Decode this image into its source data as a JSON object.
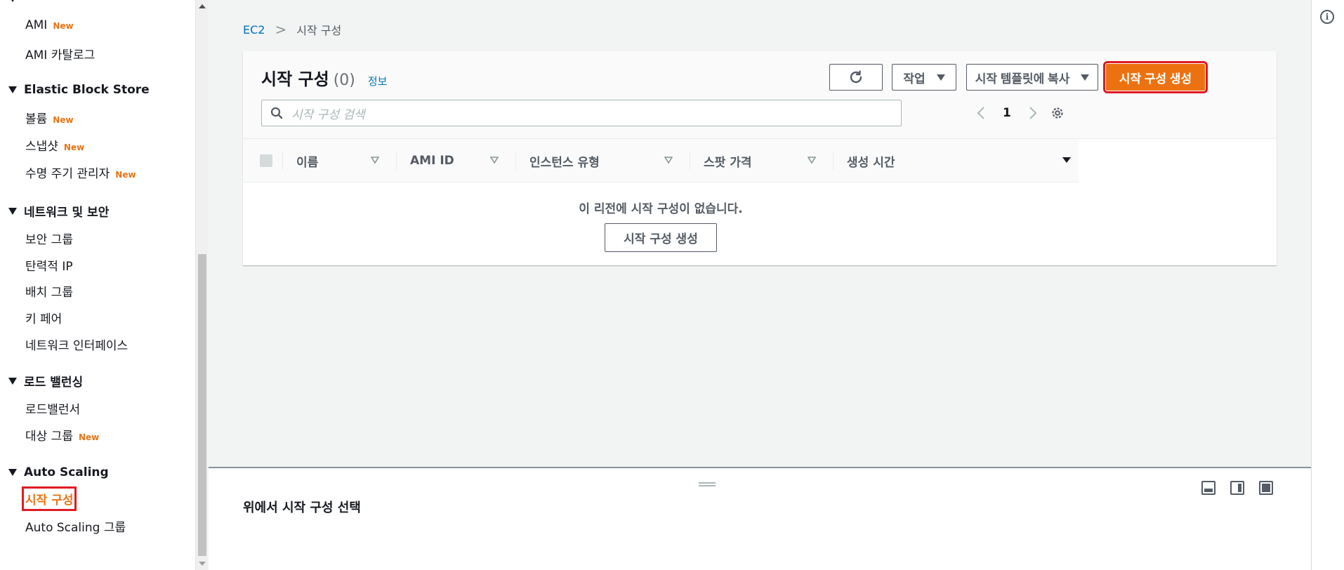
{
  "sidebar": {
    "items": [
      {
        "label": "AMI",
        "badge": "New"
      },
      {
        "label": "AMI 카탈로그",
        "badge": ""
      }
    ],
    "sections": [
      {
        "title": "Elastic Block Store",
        "items": [
          {
            "label": "볼륨",
            "badge": "New"
          },
          {
            "label": "스냅샷",
            "badge": "New"
          },
          {
            "label": "수명 주기 관리자",
            "badge": "New"
          }
        ]
      },
      {
        "title": "네트워크 및 보안",
        "items": [
          {
            "label": "보안 그룹",
            "badge": ""
          },
          {
            "label": "탄력적 IP",
            "badge": ""
          },
          {
            "label": "배치 그룹",
            "badge": ""
          },
          {
            "label": "키 페어",
            "badge": ""
          },
          {
            "label": "네트워크 인터페이스",
            "badge": ""
          }
        ]
      },
      {
        "title": "로드 밸런싱",
        "items": [
          {
            "label": "로드밸런서",
            "badge": ""
          },
          {
            "label": "대상 그룹",
            "badge": "New"
          }
        ]
      },
      {
        "title": "Auto Scaling",
        "items": [
          {
            "label": "시작 구성",
            "badge": "",
            "active": true
          },
          {
            "label": "Auto Scaling 그룹",
            "badge": ""
          }
        ]
      }
    ]
  },
  "breadcrumb": {
    "root": "EC2",
    "separator": ">",
    "current": "시작 구성"
  },
  "header": {
    "title": "시작 구성",
    "count": "(0)",
    "info": "정보",
    "actions_label": "작업",
    "copy_label": "시작 템플릿에 복사",
    "create_label": "시작 구성 생성"
  },
  "search": {
    "placeholder": "시작 구성 검색"
  },
  "pagination": {
    "current_page": "1"
  },
  "table": {
    "columns": [
      "이름",
      "AMI ID",
      "인스턴스 유형",
      "스팟 가격",
      "생성 시간"
    ],
    "empty_message": "이 리전에 시작 구성이 없습니다.",
    "empty_button": "시작 구성 생성"
  },
  "split_panel": {
    "title": "위에서 시작 구성 선택"
  },
  "colors": {
    "accent": "#ec7211",
    "link": "#0073bb",
    "highlight": "#e01b24"
  }
}
